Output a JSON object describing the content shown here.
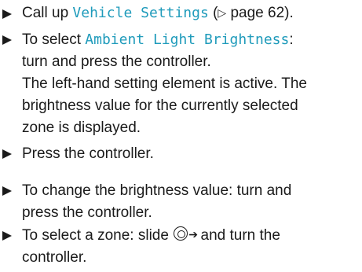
{
  "steps": [
    {
      "lines": [
        {
          "pre": "Call up ",
          "menu": "Vehicle Settings",
          "post_a": " (",
          "ref_glyph": "▷",
          "post_b": " page 62)."
        }
      ]
    },
    {
      "lines": [
        {
          "pre": "To select ",
          "menu": "Ambient Light Brightness",
          "post": ":"
        },
        {
          "text": "turn and press the controller."
        },
        {
          "text": "The left-hand setting element is active. The"
        },
        {
          "text": "brightness value for the currently selected"
        },
        {
          "text": "zone is displayed."
        }
      ]
    },
    {
      "lines": [
        {
          "text": "Press the controller."
        }
      ]
    },
    {
      "lines": [
        {
          "text": "To change the brightness value: turn and"
        },
        {
          "text": "press the controller."
        }
      ]
    },
    {
      "lines": [
        {
          "pre": "To select a zone: slide ",
          "icon": "controller-slide-right-icon",
          "arrow": "➔",
          "post": " and turn the"
        },
        {
          "text": "controller."
        }
      ]
    }
  ],
  "colors": {
    "menu_text": "#1f9bbb",
    "body_text": "#1a1a1a"
  }
}
